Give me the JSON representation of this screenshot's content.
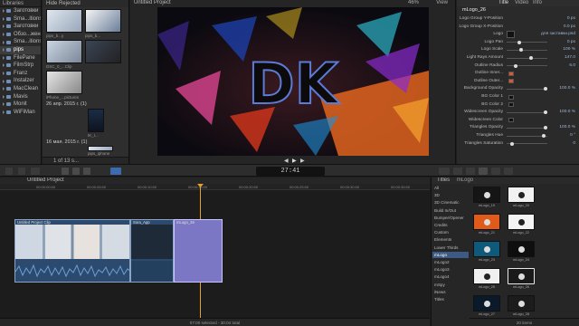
{
  "libraries": {
    "header": "Libraries",
    "items": [
      {
        "label": "Заготовки",
        "selected": false
      },
      {
        "label": "Sma...itions",
        "selected": false
      },
      {
        "label": "Заготовки",
        "selected": false
      },
      {
        "label": "Обзо...жений",
        "selected": false
      },
      {
        "label": "Sma...itions",
        "selected": false
      },
      {
        "label": "pips",
        "selected": true
      },
      {
        "label": "FilePane",
        "selected": false
      },
      {
        "label": "FilmStrp",
        "selected": false
      },
      {
        "label": "Franz",
        "selected": false
      },
      {
        "label": "Instalzer",
        "selected": false
      },
      {
        "label": "MacClean",
        "selected": false
      },
      {
        "label": "Mavis",
        "selected": false
      },
      {
        "label": "Monit",
        "selected": false
      },
      {
        "label": "WiFiMan",
        "selected": false
      }
    ]
  },
  "browser": {
    "header": "Hide Rejected",
    "group1": "26 апр. 2015 г.",
    "group1_count": "(1)",
    "group2": "16 мая. 2015 г.",
    "group2_count": "(1)",
    "captions": [
      "pips_b...y",
      "pips_b...",
      "DSC_0_...Clip",
      "",
      "iPhone_...pictures",
      "IK_I...",
      "pips_iphone"
    ],
    "footer": "1 of 13 s..."
  },
  "viewer": {
    "title": "Untitled Project",
    "zoom": "46%",
    "view_label": "View",
    "logo_text": "DK"
  },
  "inspector": {
    "tabs": [
      "Title",
      "Video",
      "Info"
    ],
    "clip_name": "mLogo_26",
    "rows": [
      {
        "label": "Logo Group Y-Position",
        "value": "0 px"
      },
      {
        "label": "Logo Group X-Position",
        "value": "0.0 px"
      },
      {
        "label": "Logo",
        "value": "для заставки.psd"
      },
      {
        "label": "Logo Pan",
        "value": "0 px"
      },
      {
        "label": "Logo Scale",
        "value": "100 %"
      },
      {
        "label": "Light Rays Amount",
        "value": "147.0"
      },
      {
        "label": "Outline Radius",
        "value": "6.0"
      },
      {
        "label": "Outline Inner...",
        "value": ""
      },
      {
        "label": "Outline Outer...",
        "value": ""
      },
      {
        "label": "Background Opacity",
        "value": "100.0 %"
      },
      {
        "label": "BG Color 1",
        "value": ""
      },
      {
        "label": "BG Color 2",
        "value": ""
      },
      {
        "label": "Widescreen Opacity",
        "value": "100.0 %"
      },
      {
        "label": "Widescreen Color",
        "value": ""
      },
      {
        "label": "Triangles Opacity",
        "value": "100.0 %"
      },
      {
        "label": "Triangles Hue",
        "value": "0 °"
      },
      {
        "label": "Triangles Saturation",
        "value": "0"
      }
    ]
  },
  "toolbar": {
    "timecode": "27:41"
  },
  "timeline": {
    "title": "Untitled Project",
    "ruler": [
      "00:00:00:00",
      "00:00:05:00",
      "00:00:10:00",
      "00:00:15:00",
      "00:00:20:00",
      "00:00:25:00",
      "00:00:30:00",
      "00:00:35:00",
      "00:00:40:00"
    ],
    "clips": [
      {
        "label": "Untitled Project Clip"
      },
      {
        "label": "Sora_App"
      },
      {
        "label": "mLogo_26"
      }
    ],
    "footer": "07:00 selected - 30:04 total"
  },
  "titles": {
    "header": "Titles",
    "sub": "mLogo",
    "categories": [
      "All",
      "3D",
      "3D Cinematic",
      "Build In/Out",
      "Bumper/Opener",
      "Credits",
      "Custom",
      "Elements",
      "Lower Thirds",
      "mLogo",
      "mLogo2",
      "mLogo3",
      "mLogo4",
      "mSpy",
      "iNews",
      "Titles"
    ],
    "selected_category": "mLogo",
    "items": [
      "mLogo_19",
      "mLogo_20",
      "mLogo_21",
      "mLogo_22",
      "mLogo_23",
      "mLogo_24",
      "mLogo_25",
      "mLogo_26",
      "mLogo_27",
      "mLogo_28"
    ],
    "footer": "20 items"
  }
}
